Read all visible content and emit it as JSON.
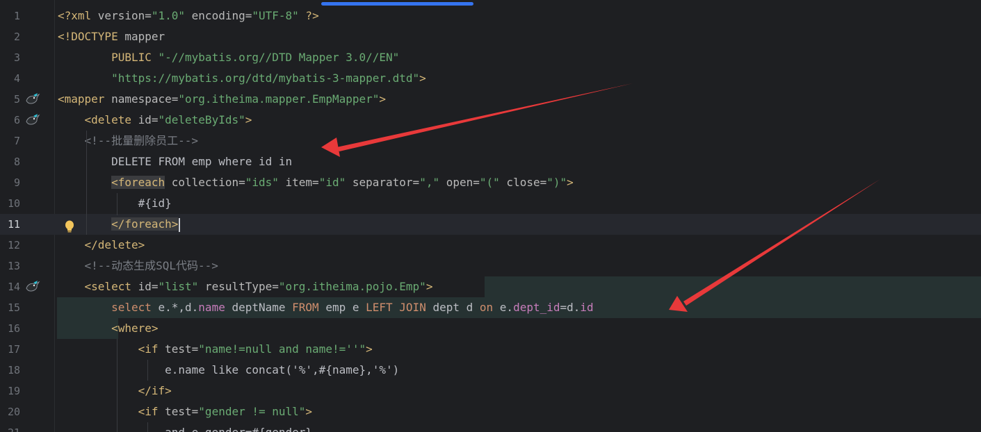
{
  "editor": {
    "current_line": 11,
    "lines": [
      {
        "num": "1",
        "tokens": [
          {
            "t": "<?xml ",
            "c": "tag"
          },
          {
            "t": "version=",
            "c": "attr"
          },
          {
            "t": "\"1.0\"",
            "c": "str"
          },
          {
            "t": " encoding=",
            "c": "attr"
          },
          {
            "t": "\"UTF-8\"",
            "c": "str"
          },
          {
            "t": " ?>",
            "c": "tag"
          }
        ]
      },
      {
        "num": "2",
        "tokens": [
          {
            "t": "<!DOCTYPE ",
            "c": "tag"
          },
          {
            "t": "mapper",
            "c": "attr"
          }
        ]
      },
      {
        "num": "3",
        "tokens": [
          {
            "t": "        PUBLIC ",
            "c": "tag"
          },
          {
            "t": "\"-//mybatis.org//DTD Mapper 3.0//EN\"",
            "c": "str"
          }
        ]
      },
      {
        "num": "4",
        "tokens": [
          {
            "t": "        \"https://mybatis.org/dtd/mybatis-3-mapper.dtd\"",
            "c": "str"
          },
          {
            "t": ">",
            "c": "tag"
          }
        ]
      },
      {
        "num": "5",
        "tokens": [
          {
            "t": "<mapper ",
            "c": "tag"
          },
          {
            "t": "namespace=",
            "c": "attr"
          },
          {
            "t": "\"org.itheima.mapper.EmpMapper\"",
            "c": "str"
          },
          {
            "t": ">",
            "c": "tag"
          }
        ]
      },
      {
        "num": "6",
        "tokens": [
          {
            "t": "    <delete ",
            "c": "tag"
          },
          {
            "t": "id=",
            "c": "attr"
          },
          {
            "t": "\"deleteByIds\"",
            "c": "str"
          },
          {
            "t": ">",
            "c": "tag"
          }
        ]
      },
      {
        "num": "7",
        "tokens": [
          {
            "t": "    <!--批量删除员工-->",
            "c": "cmt"
          }
        ]
      },
      {
        "num": "8",
        "tokens": [
          {
            "t": "        DELETE FROM emp where id in",
            "c": "plain"
          }
        ]
      },
      {
        "num": "9",
        "tokens": [
          {
            "t": "        ",
            "c": "plain"
          },
          {
            "t": "<foreach",
            "c": "tag hl"
          },
          {
            "t": " collection=",
            "c": "attr"
          },
          {
            "t": "\"ids\"",
            "c": "str"
          },
          {
            "t": " item=",
            "c": "attr"
          },
          {
            "t": "\"id\"",
            "c": "str"
          },
          {
            "t": " separator=",
            "c": "attr"
          },
          {
            "t": "\",\"",
            "c": "str"
          },
          {
            "t": " open=",
            "c": "attr"
          },
          {
            "t": "\"(\"",
            "c": "str"
          },
          {
            "t": " close=",
            "c": "attr"
          },
          {
            "t": "\")\"",
            "c": "str"
          },
          {
            "t": ">",
            "c": "tag"
          }
        ]
      },
      {
        "num": "10",
        "tokens": [
          {
            "t": "            #{id}",
            "c": "plain"
          }
        ]
      },
      {
        "num": "11",
        "tokens": [
          {
            "t": "        ",
            "c": "plain"
          },
          {
            "t": "</foreach>",
            "c": "tag hl"
          },
          {
            "t": "",
            "c": "caret"
          }
        ]
      },
      {
        "num": "12",
        "tokens": [
          {
            "t": "    </delete>",
            "c": "tag"
          }
        ]
      },
      {
        "num": "13",
        "tokens": [
          {
            "t": "    <!--动态生成SQL代码-->",
            "c": "cmt"
          }
        ]
      },
      {
        "num": "14",
        "tokens": [
          {
            "t": "    <select ",
            "c": "tag"
          },
          {
            "t": "id=",
            "c": "attr"
          },
          {
            "t": "\"list\"",
            "c": "str"
          },
          {
            "t": " resultType=",
            "c": "attr"
          },
          {
            "t": "\"org.itheima.pojo.Emp\"",
            "c": "str"
          },
          {
            "t": ">",
            "c": "tag"
          }
        ]
      },
      {
        "num": "15",
        "tokens": [
          {
            "t": "        ",
            "c": "plain"
          },
          {
            "t": "select",
            "c": "kw"
          },
          {
            "t": " e.*,d.",
            "c": "plain"
          },
          {
            "t": "name",
            "c": "fld"
          },
          {
            "t": " deptName ",
            "c": "plain"
          },
          {
            "t": "FROM",
            "c": "kw"
          },
          {
            "t": " emp e ",
            "c": "plain"
          },
          {
            "t": "LEFT JOIN",
            "c": "kw"
          },
          {
            "t": " dept d ",
            "c": "plain"
          },
          {
            "t": "on",
            "c": "kw"
          },
          {
            "t": " e.",
            "c": "plain"
          },
          {
            "t": "dept_id",
            "c": "fld"
          },
          {
            "t": "=d.",
            "c": "plain"
          },
          {
            "t": "id",
            "c": "fld"
          }
        ]
      },
      {
        "num": "16",
        "tokens": [
          {
            "t": "        <where>",
            "c": "tag"
          }
        ]
      },
      {
        "num": "17",
        "tokens": [
          {
            "t": "            <if ",
            "c": "tag"
          },
          {
            "t": "test=",
            "c": "attr"
          },
          {
            "t": "\"name!=null and name!=''\"",
            "c": "str"
          },
          {
            "t": ">",
            "c": "tag"
          }
        ]
      },
      {
        "num": "18",
        "tokens": [
          {
            "t": "                e.name like concat('%',#{name},'%')",
            "c": "plain"
          }
        ]
      },
      {
        "num": "19",
        "tokens": [
          {
            "t": "            </if>",
            "c": "tag"
          }
        ]
      },
      {
        "num": "20",
        "tokens": [
          {
            "t": "            <if ",
            "c": "tag"
          },
          {
            "t": "test=",
            "c": "attr"
          },
          {
            "t": "\"gender != null\"",
            "c": "str"
          },
          {
            "t": ">",
            "c": "tag"
          }
        ]
      },
      {
        "num": "21",
        "tokens": [
          {
            "t": "                and e.gender=#{gender}",
            "c": "plain"
          }
        ]
      }
    ],
    "gutter_icons": [
      {
        "line": 5,
        "icon": "mybatis-bird-icon"
      },
      {
        "line": 6,
        "icon": "mybatis-bird-icon"
      },
      {
        "line": 14,
        "icon": "mybatis-bird-icon"
      }
    ],
    "intention_bulb": {
      "line": 11,
      "icon": "lightbulb-icon"
    },
    "annotation_color": "#e8393a",
    "scroll_accent": "#3574f0"
  }
}
